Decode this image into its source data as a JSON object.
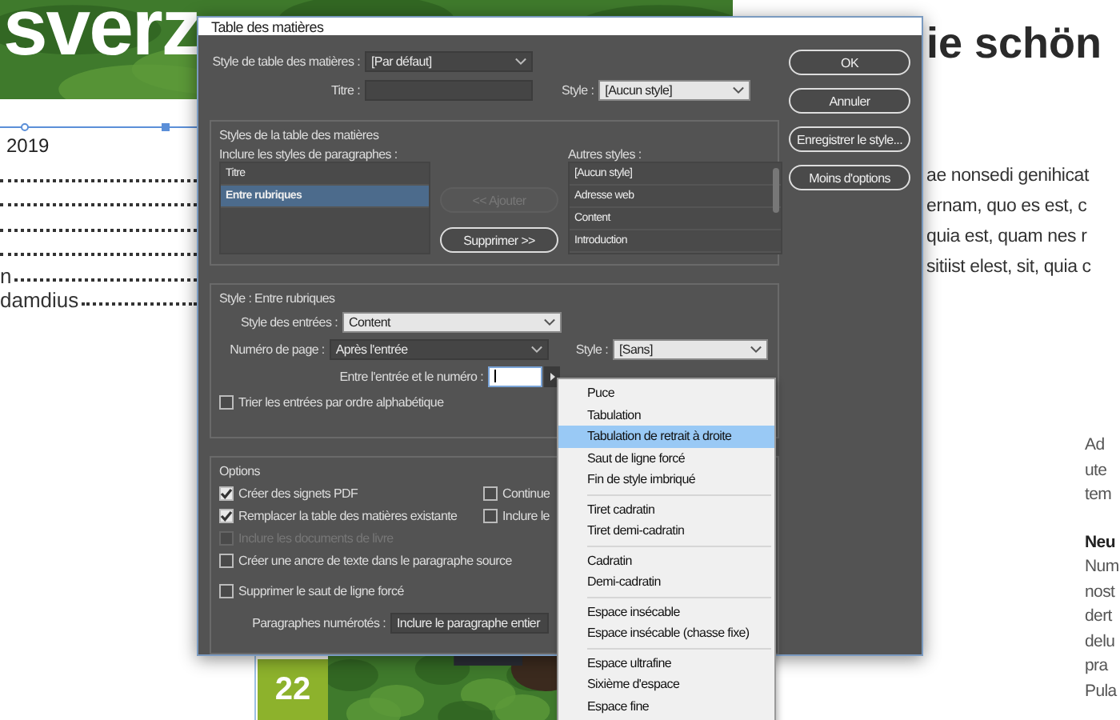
{
  "document": {
    "banner_title": "sverz",
    "year": "2019",
    "toc_entries": [
      {
        "text": "n"
      },
      {
        "text": "damdius"
      }
    ],
    "heading": "ie schön",
    "paragraph_lines": [
      "ae nonsedi genihicat",
      "ernam, quo es est, c",
      "quia est, quam nes r",
      "sitiist elest, sit, quia c"
    ],
    "side_column": [
      {
        "text": "Ad",
        "kind": "body"
      },
      {
        "text": "ute",
        "kind": "body"
      },
      {
        "text": "tem",
        "kind": "body"
      },
      {
        "text": "Neu",
        "kind": "bold"
      },
      {
        "text": "Num",
        "kind": "body"
      },
      {
        "text": "nost",
        "kind": "body"
      },
      {
        "text": "dert",
        "kind": "body"
      },
      {
        "text": "delu",
        "kind": "body"
      },
      {
        "text": "pra",
        "kind": "body"
      },
      {
        "text": "Pula",
        "kind": "body"
      }
    ],
    "page_number": "22"
  },
  "dialog": {
    "title": "Table des matières",
    "toc_style": {
      "label": "Style de table des matières :",
      "value": "[Par défaut]",
      "kind": "select"
    },
    "title_field": {
      "label": "Titre :"
    },
    "title_style": {
      "label": "Style :",
      "value": "[Aucun style]",
      "kind": "combo"
    },
    "buttons": [
      {
        "label": "OK",
        "disabled": false
      },
      {
        "label": "Annuler",
        "disabled": false
      },
      {
        "label": "Enregistrer le style...",
        "disabled": false
      },
      {
        "label": "Moins d'options",
        "disabled": false
      }
    ],
    "styles_group": {
      "title": "Styles de la table des matières",
      "include_label": "Inclure les styles de paragraphes :",
      "included": [
        {
          "label": "Titre",
          "selected": false
        },
        {
          "label": "Entre rubriques",
          "selected": true
        }
      ],
      "add_button": {
        "label": "<< Ajouter",
        "disabled": true
      },
      "remove_button": {
        "label": "Supprimer >>",
        "disabled": false
      },
      "other_label": "Autres styles :",
      "other": [
        {
          "label": "[Aucun style]"
        },
        {
          "label": "Adresse web"
        },
        {
          "label": "Content"
        },
        {
          "label": "Introduction"
        }
      ]
    },
    "entry_group": {
      "title": "Style : Entre rubriques",
      "entry_style": {
        "label": "Style des entrées :",
        "value": "Content",
        "kind": "combo"
      },
      "page_number": {
        "label": "Numéro de page :",
        "value": "Après l'entrée",
        "kind": "select"
      },
      "number_style": {
        "label": "Style :",
        "value": "[Sans]",
        "kind": "combo"
      },
      "separator": {
        "label": "Entre l'entrée et le numéro :"
      },
      "sort": {
        "label": "Trier les entrées par ordre alphabétique",
        "checked": false,
        "disabled": false
      }
    },
    "options": {
      "title": "Options",
      "checkboxes": [
        {
          "label": "Créer des signets PDF",
          "checked": true,
          "disabled": false
        },
        {
          "label": "Remplacer la table des matières existante",
          "checked": true,
          "disabled": false
        },
        {
          "label": "Inclure les documents de livre",
          "checked": false,
          "disabled": true
        },
        {
          "label": "Créer une ancre de texte dans le paragraphe source",
          "checked": false,
          "disabled": false
        },
        {
          "label": "Supprimer le saut de ligne forcé",
          "checked": false,
          "disabled": false
        }
      ],
      "right_checkboxes": [
        {
          "label": "Continue",
          "checked": false,
          "disabled": false
        },
        {
          "label": "Inclure le",
          "checked": false,
          "disabled": false
        }
      ],
      "numbered": {
        "label": "Paragraphes numérotés :",
        "value": "Inclure le paragraphe entier",
        "kind": "select"
      }
    }
  },
  "menu": {
    "groups": [
      {
        "items": [
          {
            "label": "Puce",
            "selected": false
          },
          {
            "label": "Tabulation",
            "selected": false
          },
          {
            "label": "Tabulation de retrait à droite",
            "selected": true
          },
          {
            "label": "Saut de ligne forcé",
            "selected": false
          },
          {
            "label": "Fin de style imbriqué",
            "selected": false
          }
        ]
      },
      {
        "items": [
          {
            "label": "Tiret cadratin",
            "selected": false
          },
          {
            "label": "Tiret demi-cadratin",
            "selected": false
          }
        ]
      },
      {
        "items": [
          {
            "label": "Cadratin",
            "selected": false
          },
          {
            "label": "Demi-cadratin",
            "selected": false
          }
        ]
      },
      {
        "items": [
          {
            "label": "Espace insécable",
            "selected": false
          },
          {
            "label": "Espace insécable (chasse fixe)",
            "selected": false
          }
        ]
      },
      {
        "items": [
          {
            "label": "Espace ultrafine",
            "selected": false
          },
          {
            "label": "Sixième d'espace",
            "selected": false
          },
          {
            "label": "Espace fine",
            "selected": false
          }
        ]
      }
    ]
  }
}
